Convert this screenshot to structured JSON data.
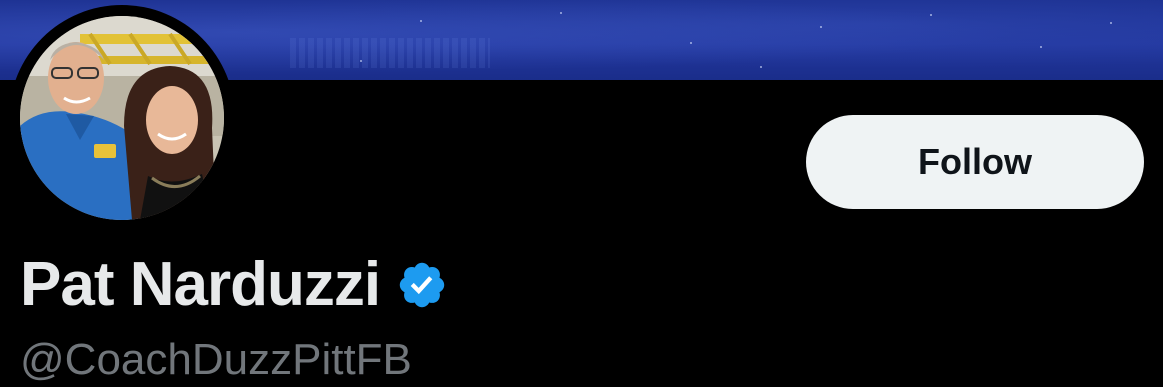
{
  "profile": {
    "display_name": "Pat Narduzzi",
    "handle": "@CoachDuzzPittFB",
    "verified": true,
    "follow_label": "Follow"
  },
  "banner": {
    "description": "",
    "color": "#1f3496"
  },
  "avatar": {
    "icon": "profile-photo"
  },
  "icons": {
    "verified": "verified-badge-icon"
  },
  "colors": {
    "background": "#000000",
    "name_text": "#e7e9ea",
    "handle_text": "#71767b",
    "button_bg": "#eff3f4",
    "button_text": "#0f1419",
    "verified_blue": "#1d9bf0"
  }
}
